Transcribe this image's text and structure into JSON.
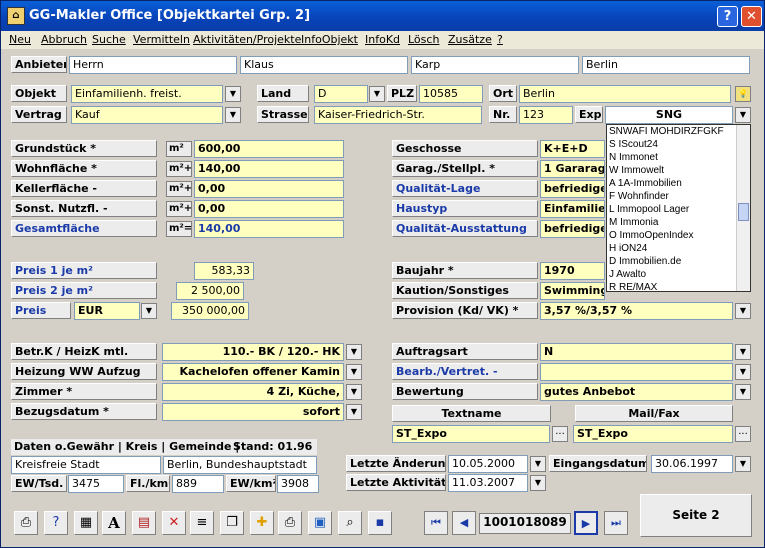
{
  "window": {
    "title": "GG-Makler Office [Objektkartei Grp. 2]",
    "help_label": "?",
    "close_label": "✕"
  },
  "menu": [
    "Neu",
    "Abbruch",
    "Suche",
    "Vermitteln",
    "Aktivitäten/Projekte",
    "InfoObjekt",
    "InfoKd",
    "Lösch",
    "Zusätze",
    "?"
  ],
  "anbieter": {
    "label": "Anbieter",
    "anrede": "Herrn",
    "vorname": "Klaus",
    "name": "Karp",
    "ort": "Berlin"
  },
  "objekt": {
    "label": "Objekt",
    "value": "Einfamilienh. freist.",
    "land_label": "Land",
    "land": "D",
    "plz_label": "PLZ",
    "plz": "10585",
    "ort_label": "Ort",
    "ort": "Berlin"
  },
  "vertrag": {
    "label": "Vertrag",
    "value": "Kauf",
    "strasse_label": "Strasse",
    "strasse": "Kaiser-Friedrich-Str.",
    "nr_label": "Nr.",
    "nr": "123",
    "exp_label": "Exp",
    "exp": "SNG"
  },
  "exp_list": [
    "SNWAFI MOHDIRZFGKF",
    "S IScout24",
    "N Immonet",
    "W Immowelt",
    "A 1A-Immobilien",
    "F Wohnfinder",
    "L Immopool Lager",
    "M Immonia",
    "O ImmoOpenIndex",
    "H iON24",
    "D Immobilien.de",
    "J Awalto",
    "R RE/MAX"
  ],
  "flaechen": [
    {
      "label": "Grundstück *",
      "unit": "m²",
      "value": "600,00",
      "blue": false
    },
    {
      "label": "Wohnfläche *",
      "unit": "m²+",
      "value": "140,00",
      "blue": false
    },
    {
      "label": "Kellerfläche -",
      "unit": "m²+",
      "value": "0,00",
      "blue": false
    },
    {
      "label": "Sonst. Nutzfl. -",
      "unit": "m²+",
      "value": "0,00",
      "blue": false
    },
    {
      "label": "Gesamtfläche",
      "unit": "m²=",
      "value": "140,00",
      "blue": true
    }
  ],
  "rechts": [
    {
      "label": "Geschosse",
      "value": "K+E+D",
      "blue": false
    },
    {
      "label": "Garag./Stellpl. *",
      "value": "1 Gararage",
      "blue": false
    },
    {
      "label": "Qualität-Lage",
      "value": "befriediger",
      "blue": true
    },
    {
      "label": "Haustyp",
      "value": "Einfamilien",
      "blue": true
    },
    {
      "label": "Qualität-Ausstattung",
      "value": "befriediger",
      "blue": true
    }
  ],
  "preise": {
    "p1_label": "Preis 1  je m²",
    "p1": "583,33",
    "p2_label": "Preis 2  je m²",
    "p2": "2 500,00",
    "preis_label": "Preis",
    "waehrung": "EUR",
    "preis": "350 000,00"
  },
  "baujahr": {
    "label": "Baujahr *",
    "value": "1970",
    "kaution_label": "Kaution/Sonstiges",
    "kaution": "Swimmingp",
    "prov_label": "Provision (Kd/ VK) *",
    "prov": "3,57 %/3,57 %"
  },
  "links2": [
    {
      "label": "Betr.K / HeizK mtl.",
      "value": "110.- BK / 120.- HK"
    },
    {
      "label": "Heizung WW Aufzug",
      "value": "Kachelofen offener Kamin"
    },
    {
      "label": "Zimmer *",
      "value": "4 Zi, Küche,"
    },
    {
      "label": "Bezugsdatum *",
      "value": "sofort"
    }
  ],
  "rechts2": {
    "auftrag_label": "Auftragsart",
    "auftrag": "N",
    "bearb_label": "Bearb./Vertret. -",
    "bearb": "",
    "bewertung_label": "Bewertung",
    "bewertung": "gutes Anbebot",
    "textname_label": "Textname",
    "textname": "ST_Expo",
    "mail_label": "Mail/Fax",
    "mail": "ST_Expo"
  },
  "gemeinde": {
    "header": "Daten o.Gewähr | Kreis | Gemeinde |",
    "stand": "Stand:  01.96",
    "kreis": "Kreisfreie Stadt",
    "gemeinde": "Berlin, Bundeshauptstadt",
    "ew_label": "EW/Tsd.",
    "ew": "3475",
    "fl_label": "Fl./km²",
    "fl": "889",
    "ewkm_label": "EW/km²",
    "ewkm": "3908"
  },
  "daten": {
    "aend_label": "Letzte Änderung",
    "aend": "10.05.2000",
    "eing_label": "Eingangsdatum",
    "eing": "30.06.1997",
    "akt_label": "Letzte Aktivität",
    "akt": "11.03.2007"
  },
  "nav": {
    "record": "1001018089",
    "seite": "Seite 2"
  }
}
